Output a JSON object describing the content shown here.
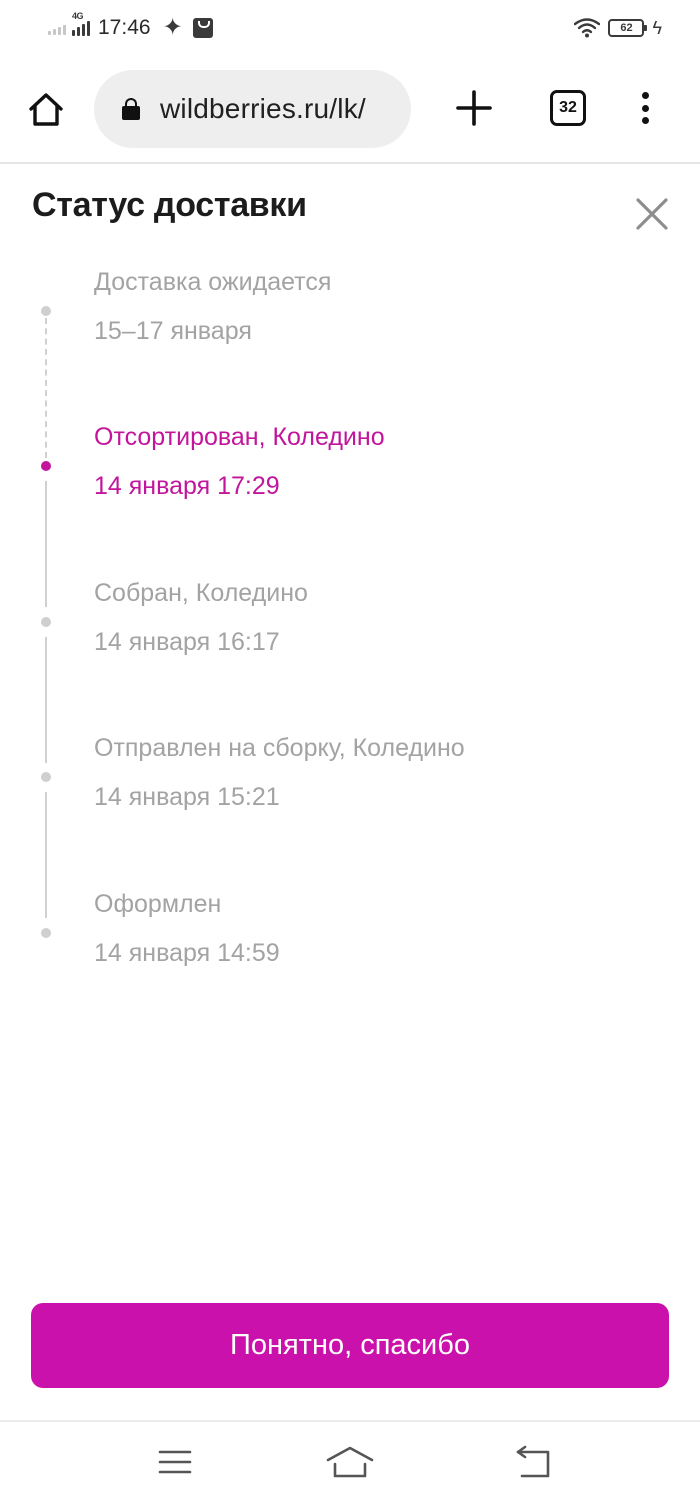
{
  "status_bar": {
    "time": "17:46",
    "network_tag": "4G",
    "battery_level": "62",
    "icons": [
      "signal-icon",
      "signal-4g-icon",
      "sparkle-icon",
      "bag-notification-icon",
      "wifi-icon",
      "battery-icon",
      "charging-bolt-icon"
    ]
  },
  "browser": {
    "url": "wildberries.ru/lk/",
    "tab_count": "32",
    "icons": [
      "home-icon",
      "lock-icon",
      "plus-icon",
      "tabs-icon",
      "more-vert-icon"
    ]
  },
  "sheet": {
    "title": "Статус доставки",
    "close_icon": "close-icon",
    "events": [
      {
        "title": "Доставка ожидается",
        "date": "15–17 января",
        "state": "pending"
      },
      {
        "title": "Отсортирован, Коледино",
        "date": "14 января 17:29",
        "state": "current"
      },
      {
        "title": "Собран, Коледино",
        "date": "14 января 16:17",
        "state": "done"
      },
      {
        "title": "Отправлен на сборку, Коледино",
        "date": "14 января 15:21",
        "state": "done"
      },
      {
        "title": "Оформлен",
        "date": "14 января 14:59",
        "state": "done"
      }
    ],
    "button_label": "Понятно, спасибо"
  },
  "colors": {
    "accent": "#cb11ab",
    "active_text": "#c2159c",
    "muted_text": "#a3a3a3",
    "timeline": "#d0d0d0"
  },
  "nav_bar": {
    "icons": [
      "recents-icon",
      "home-nav-icon",
      "back-icon"
    ]
  }
}
